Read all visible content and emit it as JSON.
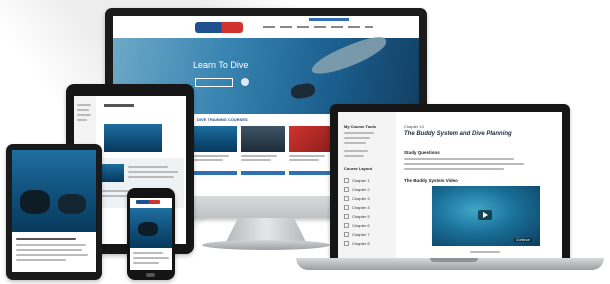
{
  "colors": {
    "ocean_light": "#1f6ea0",
    "ocean_dark": "#083a5c",
    "brand_red": "#d2322d",
    "brand_blue": "#1f4f8f",
    "accent_blue": "#2f6fb3"
  },
  "desktop": {
    "hero_title": "Learn To Dive",
    "section_heading": "DIVE TRAINING COURSES"
  },
  "laptop": {
    "sidebar_heading": "My Course Tools",
    "course_layout_heading": "Course Layout",
    "chapters": [
      "Chapter 1",
      "Chapter 2",
      "Chapter 3",
      "Chapter 4",
      "Chapter 5",
      "Chapter 6",
      "Chapter 7",
      "Chapter 8"
    ],
    "chapter_label": "Chapter 14",
    "chapter_title": "The Buddy System and Dive Planning",
    "study_questions": "Study Questions",
    "video_heading": "The Buddy System Video",
    "video_control": "Continue"
  },
  "icons": [
    "play-icon",
    "checkbox-icon"
  ]
}
